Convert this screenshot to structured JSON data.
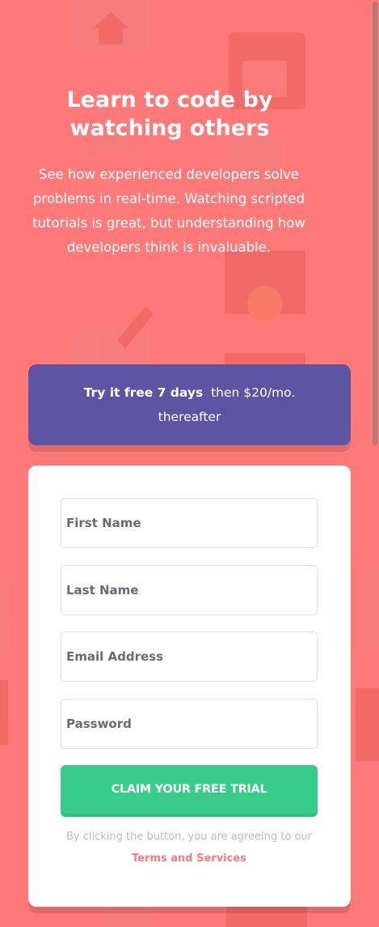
{
  "hero": {
    "title": "Learn to code by watching others",
    "subtitle": "See how experienced developers solve problems in real-time. Watching scripted tutorials is great, but understanding how developers think is invaluable."
  },
  "promo": {
    "bold": "Try it free 7 days",
    "rest_line1": "then $20/mo.",
    "rest_line2": "thereafter"
  },
  "form": {
    "first_name_placeholder": "First Name",
    "last_name_placeholder": "Last Name",
    "email_placeholder": "Email Address",
    "password_placeholder": "Password",
    "submit_label": "CLAIM YOUR FREE TRIAL",
    "terms_prefix": "By clicking the button, you are agreeing to our",
    "terms_link": "Terms and Services"
  },
  "colors": {
    "background": "#ff7979",
    "promo": "#5e54a4",
    "button": "#38cc8b",
    "terms_link": "#ff7979"
  }
}
